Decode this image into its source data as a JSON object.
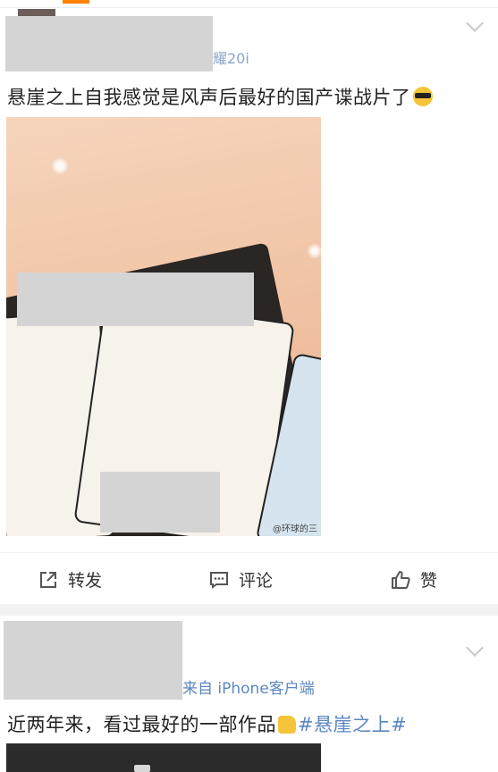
{
  "post1": {
    "meta_suffix": "耀20i",
    "text": "悬崖之上自我感觉是风声后最好的国产谍战片了",
    "emoji": "sunglasses-emoji",
    "image": {
      "description": "movie-tickets-photo",
      "watermark": "@环球的三"
    },
    "actions": {
      "repost": "转发",
      "comment": "评论",
      "like": "赞"
    }
  },
  "post2": {
    "meta_suffix": "来自 iPhone客户端",
    "text": "近两年来，看过最好的一部作品",
    "emoji": "thumbs-up-emoji",
    "hashtag": "#悬崖之上#"
  },
  "colors": {
    "link": "#5b87c0",
    "separator": "#f2f2f2",
    "redaction": "#d4d4d4"
  }
}
